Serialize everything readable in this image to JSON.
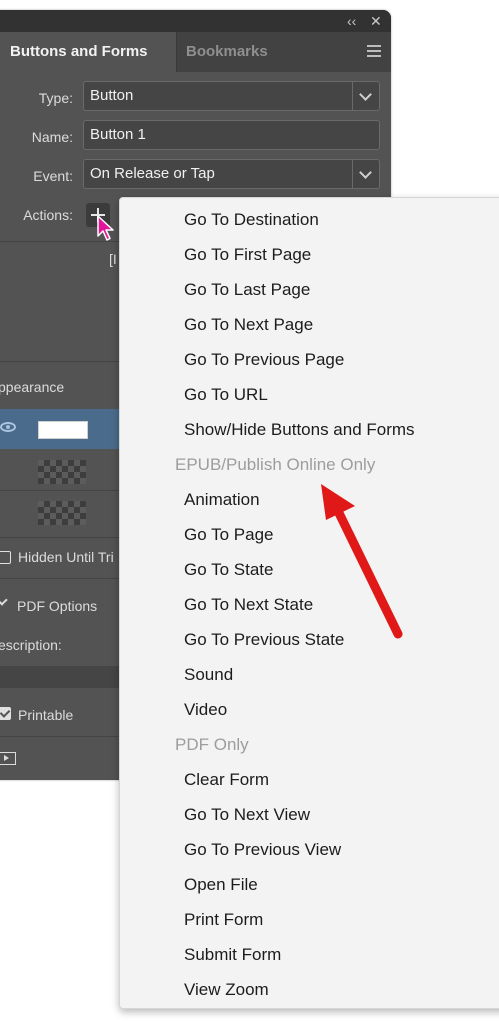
{
  "panel": {
    "tabs": {
      "active": "Buttons and Forms",
      "inactive": "Bookmarks"
    },
    "fields": {
      "type_label": "Type:",
      "type_value": "Button",
      "name_label": "Name:",
      "name_value": "Button 1",
      "event_label": "Event:",
      "event_value": "On Release or Tap",
      "actions_label": "Actions:"
    },
    "truncated_bracket": "[I",
    "appearance_label": "ppearance",
    "hidden_label": "Hidden Until Tri",
    "pdf_options_label": "PDF Options",
    "description_label": "escription:",
    "printable_label": "Printable",
    "printable_checked": true
  },
  "menu": {
    "items_top": [
      "Go To Destination",
      "Go To First Page",
      "Go To Last Page",
      "Go To Next Page",
      "Go To Previous Page",
      "Go To URL",
      "Show/Hide Buttons and Forms"
    ],
    "header_epub": "EPUB/Publish Online Only",
    "items_epub": [
      "Animation",
      "Go To Page",
      "Go To State",
      "Go To Next State",
      "Go To Previous State",
      "Sound",
      "Video"
    ],
    "header_pdf": "PDF Only",
    "items_pdf": [
      "Clear Form",
      "Go To Next View",
      "Go To Previous View",
      "Open File",
      "Print Form",
      "Submit Form",
      "View Zoom"
    ]
  },
  "colors": {
    "panel_bg": "#535353",
    "menu_bg": "#f3f3f3",
    "annotation_arrow": "#e01818",
    "cursor": "#e0179b"
  }
}
